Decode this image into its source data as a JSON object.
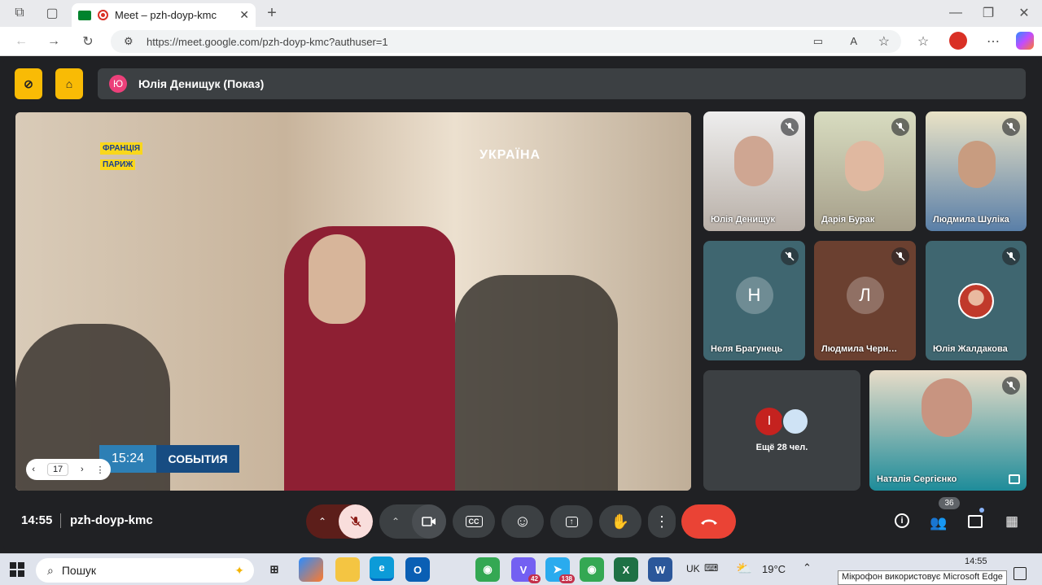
{
  "tab": {
    "title": "Meet – pzh-doyp-kmc"
  },
  "url": "https://meet.google.com/pzh-doyp-kmc?authuser=1",
  "presenter": {
    "initial": "Ю",
    "label": "Юлія Денищук (Показ)"
  },
  "stage": {
    "overlay_country": "ФРАНЦІЯ",
    "overlay_city": "ПАРИЖ",
    "channel_logo": "УКРАЇНА",
    "news_time": "15:24",
    "news_brand": "СОБЫТИЯ",
    "page_number": "17"
  },
  "participants": [
    {
      "name": "Юлія Денищук"
    },
    {
      "name": "Дарія Бурак"
    },
    {
      "name": "Людмила Шуліка"
    },
    {
      "name": "Неля Брагунець",
      "initial": "Н"
    },
    {
      "name": "Людмила Черн…",
      "initial": "Л"
    },
    {
      "name": "Юлія Жалдакова"
    },
    {
      "name": "Наталія Сергієнко"
    }
  ],
  "others": {
    "initial": "І",
    "label": "Ещё 28 чел."
  },
  "bottom": {
    "time": "14:55",
    "meeting_code": "pzh-doyp-kmc",
    "people_count": "36"
  },
  "taskbar": {
    "search_placeholder": "Пошук",
    "lang": "UK",
    "weather": "19°C",
    "clock_time": "14:55",
    "viber_badge": "42",
    "telegram_badge": "138",
    "tooltip": "Мікрофон використовує Microsoft Edge"
  },
  "colors": {
    "end_call": "#ea4335",
    "muted_bg": "#f9dedc",
    "accent_yellow": "#f9bb05"
  }
}
